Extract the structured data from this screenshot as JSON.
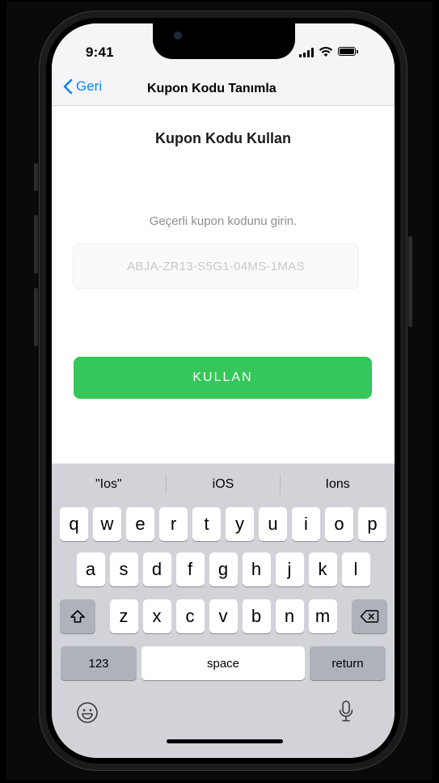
{
  "status": {
    "time": "9:41"
  },
  "navbar": {
    "back_label": "Geri",
    "title": "Kupon Kodu Tanımla"
  },
  "main": {
    "heading": "Kupon Kodu Kullan",
    "hint": "Geçerli kupon kodunu girin.",
    "coupon_placeholder": "ABJA-ZR13-S5G1-04MS-1MAS",
    "use_button": "KULLAN"
  },
  "keyboard": {
    "suggestions": [
      "\"Ios\"",
      "iOS",
      "Ions"
    ],
    "row1": [
      "q",
      "w",
      "e",
      "r",
      "t",
      "y",
      "u",
      "i",
      "o",
      "p"
    ],
    "row2": [
      "a",
      "s",
      "d",
      "f",
      "g",
      "h",
      "j",
      "k",
      "l"
    ],
    "row3": [
      "z",
      "x",
      "c",
      "v",
      "b",
      "n",
      "m"
    ],
    "numbers_label": "123",
    "space_label": "space",
    "return_label": "return"
  },
  "colors": {
    "accent": "#0a84ff",
    "button": "#34c759"
  }
}
